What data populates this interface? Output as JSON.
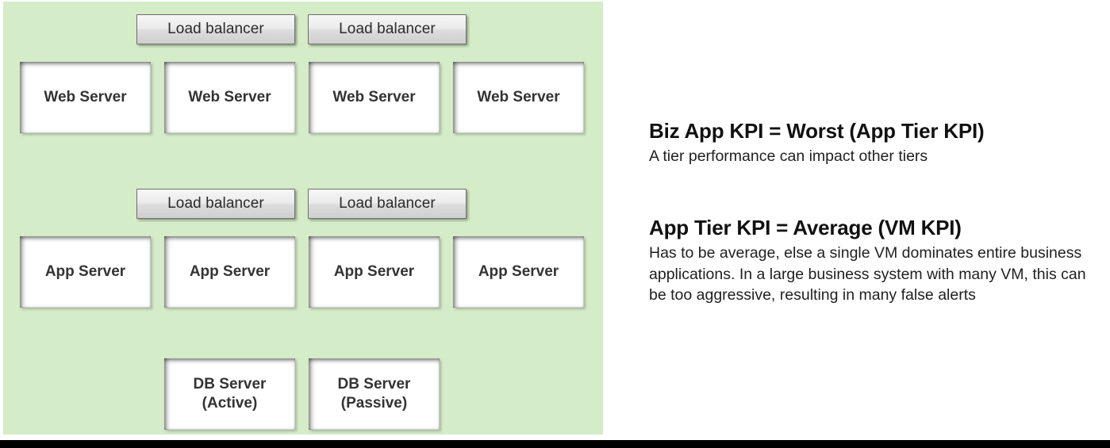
{
  "colors": {
    "panel_background": "#d4ecc8",
    "node_fill": "#ffffff",
    "node_text": "#333333",
    "load_balancer_fill": "#e8e8e8",
    "load_balancer_border": "#6e6e6e",
    "heading_text": "#111111",
    "body_text": "#1f1f1f",
    "bottom_rule": "#000000",
    "page_background": "#ffffff"
  },
  "diagram": {
    "tiers": [
      {
        "id": "web-tier",
        "load_balancers": [
          {
            "label": "Load balancer"
          },
          {
            "label": "Load balancer"
          }
        ],
        "nodes": [
          {
            "label": "Web Server"
          },
          {
            "label": "Web Server"
          },
          {
            "label": "Web Server"
          },
          {
            "label": "Web Server"
          }
        ]
      },
      {
        "id": "app-tier",
        "load_balancers": [
          {
            "label": "Load balancer"
          },
          {
            "label": "Load balancer"
          }
        ],
        "nodes": [
          {
            "label": "App Server"
          },
          {
            "label": "App Server"
          },
          {
            "label": "App Server"
          },
          {
            "label": "App Server"
          }
        ]
      },
      {
        "id": "db-tier",
        "load_balancers": [],
        "nodes": [
          {
            "label_line1": "DB Server",
            "label_line2": "(Active)"
          },
          {
            "label_line1": "DB Server",
            "label_line2": "(Passive)"
          }
        ]
      }
    ]
  },
  "notes": [
    {
      "heading": "Biz App KPI = Worst (App Tier KPI)",
      "body": "A tier performance can impact other tiers"
    },
    {
      "heading": "App Tier KPI = Average (VM KPI)",
      "body": "Has to be average, else a single VM dominates entire business applications. In a large business system with many VM, this can be too aggressive, resulting in many false alerts"
    }
  ]
}
